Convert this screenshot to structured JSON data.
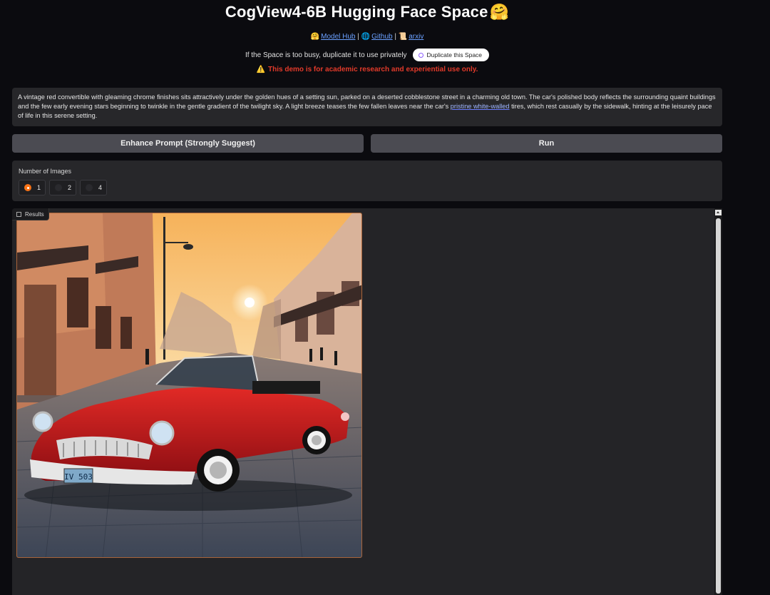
{
  "header": {
    "title": "CogView4-6B Hugging Face Space",
    "title_emoji": "🤗",
    "links": [
      {
        "icon": "🤗",
        "label": "Model Hub"
      },
      {
        "icon": "🌐",
        "label": "Github"
      },
      {
        "icon": "📜",
        "label": "arxiv"
      }
    ],
    "separator": "|",
    "busy_text": "If the Space is too busy, duplicate it to use privately",
    "duplicate_label": "Duplicate this Space",
    "warning": "This demo is for academic research and experiential use only.",
    "warning_icon": "⚠️"
  },
  "prompt": {
    "text_before": "A vintage red convertible with gleaming chrome finishes sits attractively under the golden hues of a setting sun, parked on a deserted cobblestone street in a charming old town. The car's polished body reflects the surrounding quaint buildings and the few early evening stars beginning to twinkle in the gentle gradient of the twilight sky. A light breeze teases the few fallen leaves near the car's ",
    "text_highlight": "pristine white-walled",
    "text_after": " tires, which rest casually by the sidewalk, hinting at the leisurely pace of life in this serene setting."
  },
  "actions": {
    "enhance_label": "Enhance Prompt (Strongly Suggest)",
    "run_label": "Run"
  },
  "num_images": {
    "label": "Number of Images",
    "options": [
      "1",
      "2",
      "4"
    ],
    "selected": "1"
  },
  "results": {
    "label": "Results",
    "plate_text": "IV 503"
  },
  "colors": {
    "accent": "#f97316",
    "warning": "#e23a2a",
    "link": "#6aa0ff",
    "background": "#0b0b0f",
    "panel": "#27272a"
  }
}
